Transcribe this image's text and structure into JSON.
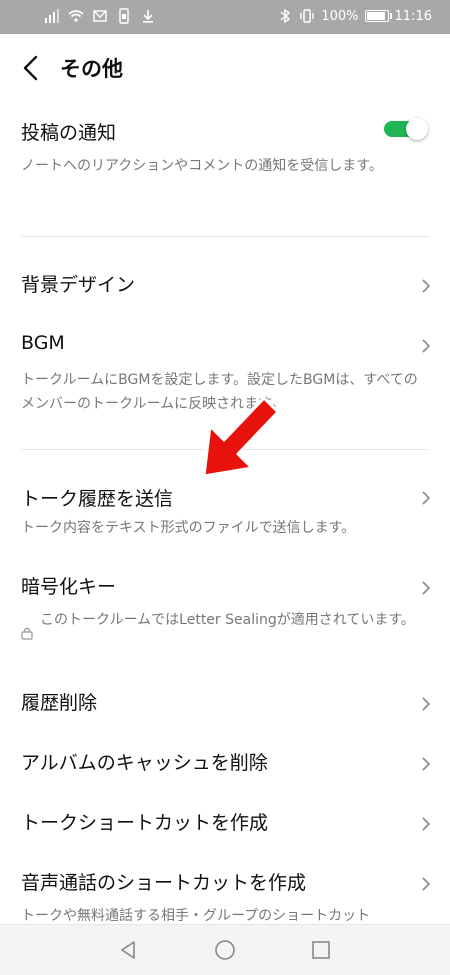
{
  "status_bar": {
    "battery": "100%",
    "time": "11:16",
    "battery_level": 1.0
  },
  "header": {
    "title": "その他"
  },
  "rows": [
    {
      "title": "投稿の通知",
      "desc": "ノートへのリアクションやコメントの通知を受信します。",
      "toggle_on": true
    },
    {
      "title": "背景デザイン"
    },
    {
      "title": "BGM",
      "desc": "トークルームにBGMを設定します。設定したBGMは、すべてのメンバーのトークルームに反映されます。"
    },
    {
      "title": "トーク履歴を送信",
      "desc": "トーク内容をテキスト形式のファイルで送信します。"
    },
    {
      "title": "暗号化キー",
      "desc": "このトークルームではLetter Sealingが適用されています。"
    },
    {
      "title": "履歴削除"
    },
    {
      "title": "アルバムのキャッシュを削除"
    },
    {
      "title": "トークショートカットを作成"
    },
    {
      "title": "音声通話のショートカットを作成",
      "desc": "トークや無料通話する相手・グループのショートカット"
    }
  ],
  "colors": {
    "toggle_on": "#1fb554",
    "annotation_arrow": "#e8120c",
    "status_bar": "#a8a8a8"
  },
  "icons": {
    "back": "chevron-left-icon",
    "row_chevron": "chevron-right-icon",
    "lock": "lock-icon",
    "nav_back": "triangle-back-icon",
    "nav_home": "circle-home-icon",
    "nav_recents": "square-recents-icon"
  }
}
